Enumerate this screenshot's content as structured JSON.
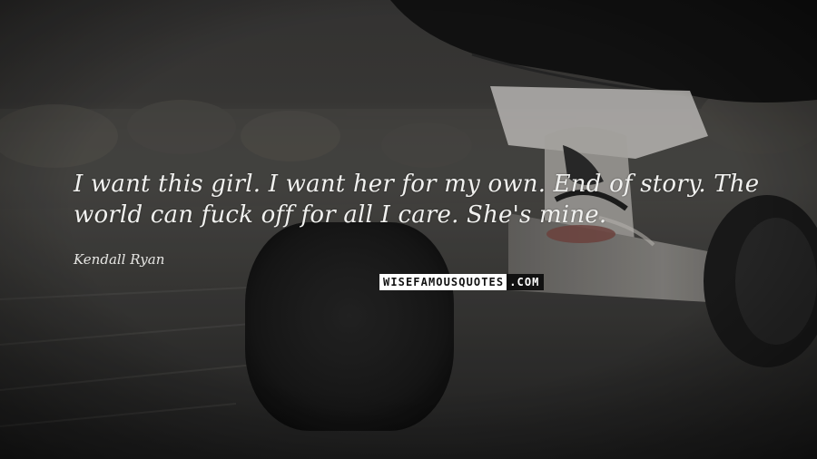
{
  "quote": {
    "text": "I want this girl. I want her for my own. End of story. The world can fuck off for all I care. She's mine.",
    "author": "Kendall Ryan"
  },
  "watermark": {
    "left_text": "WISEFAMOUSQUOTES",
    "right_text": ".COM"
  },
  "colors": {
    "text": "#f1f1ef",
    "background": "#3f3e3c"
  }
}
